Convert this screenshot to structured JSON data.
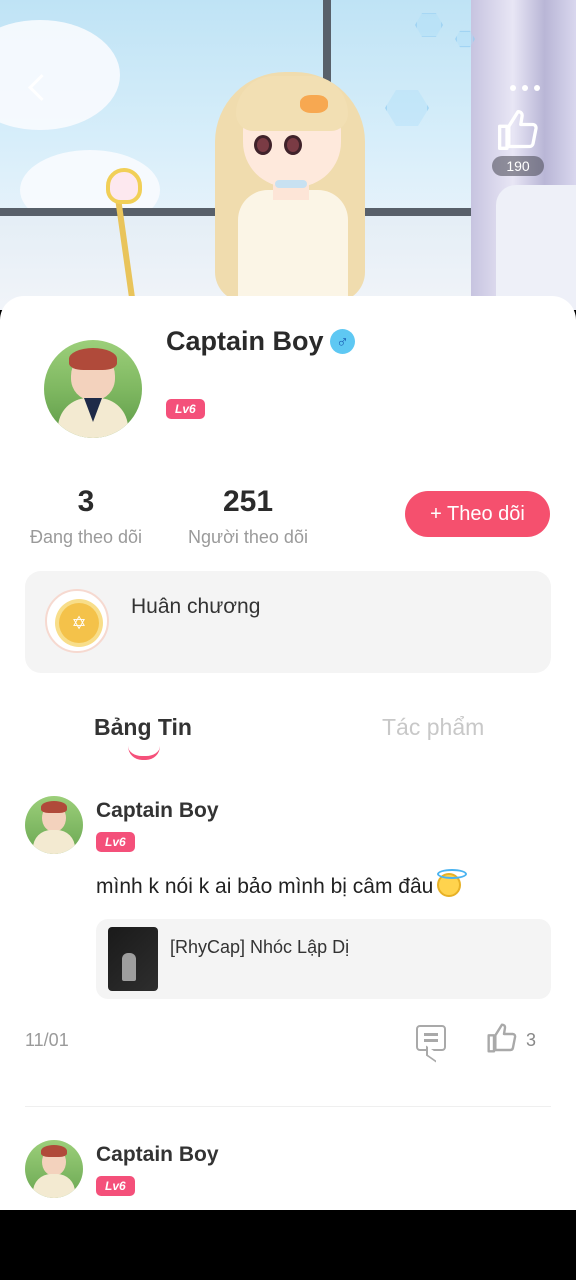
{
  "header": {
    "like_count": "190"
  },
  "profile": {
    "name": "Captain Boy",
    "gender_symbol": "♂",
    "level": "Lv6",
    "following_count": "3",
    "following_label": "Đang theo dõi",
    "followers_count": "251",
    "followers_label": "Người theo dõi",
    "follow_button": "+ Theo dõi",
    "medal_label": "Huân chương",
    "medal_symbol": "✡"
  },
  "tabs": [
    {
      "label": "Bảng Tin",
      "active": true
    },
    {
      "label": "Tác phẩm",
      "active": false
    }
  ],
  "posts": [
    {
      "author": "Captain Boy",
      "level": "Lv6",
      "text": "mình k nói k ai bảo mình bị câm đâu",
      "work_title": "[RhyCap] Nhóc Lập Dị",
      "date": "11/01",
      "likes": "3"
    },
    {
      "author": "Captain Boy",
      "level": "Lv6"
    }
  ],
  "colors": {
    "accent": "#f5506e",
    "level_badge": "#f4507a",
    "gender_badge": "#5ec8f3"
  }
}
